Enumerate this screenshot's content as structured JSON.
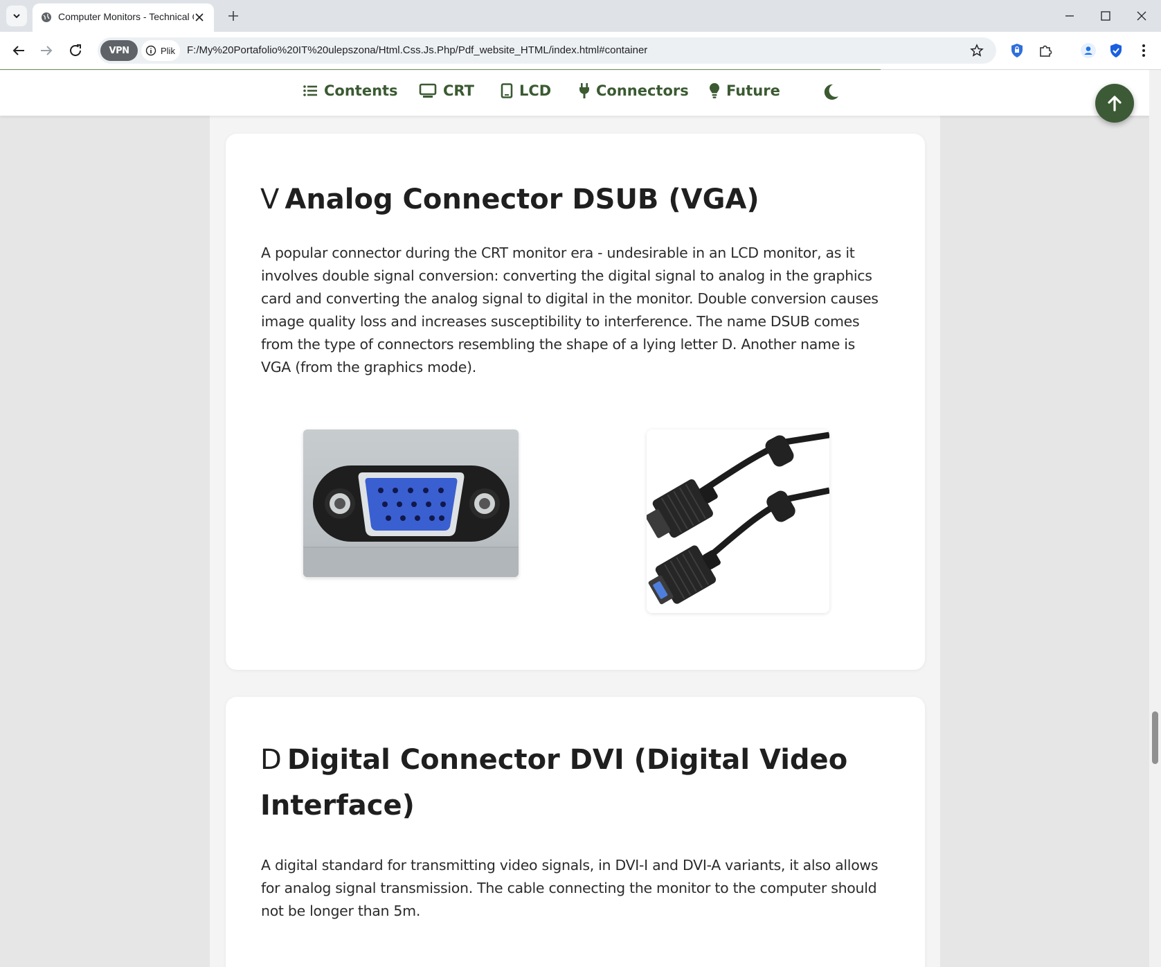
{
  "browser": {
    "tab_title": "Computer Monitors - Technical Ov",
    "vpn_label": "VPN",
    "site_chip": "Plik",
    "url": "F:/My%20Portafolio%20IT%20ulepszona/Html.Css.Js.Php/Pdf_website_HTML/index.html#container"
  },
  "nav": {
    "items": [
      {
        "label": "Contents",
        "icon": "list-icon"
      },
      {
        "label": "CRT",
        "icon": "monitor-icon"
      },
      {
        "label": "LCD",
        "icon": "tablet-icon"
      },
      {
        "label": "Connectors",
        "icon": "plug-icon"
      },
      {
        "label": "Future",
        "icon": "lightbulb-icon"
      }
    ],
    "theme_icon": "moon-icon",
    "back_to_top_icon": "arrow-up-icon"
  },
  "sections": [
    {
      "icon_glyph": "V",
      "title": "Analog Connector DSUB (VGA)",
      "body": "A popular connector during the CRT monitor era - undesirable in an LCD monitor, as it involves double signal conversion: converting the digital signal to analog in the graphics card and converting the analog signal to digital in the monitor. Double conversion causes image quality loss and increases susceptibility to interference. The name DSUB comes from the type of connectors resembling the shape of a lying letter D. Another name is VGA (from the graphics mode)."
    },
    {
      "icon_glyph": "D",
      "title": "Digital Connector DVI (Digital Video Interface)",
      "body": "A digital standard for transmitting video signals, in DVI-I and DVI-A variants, it also allows for analog signal transmission. The cable connecting the monitor to the computer should not be longer than 5m."
    }
  ],
  "colors": {
    "accent": "#3b5a32",
    "vga_blue": "#3a5fd0"
  }
}
